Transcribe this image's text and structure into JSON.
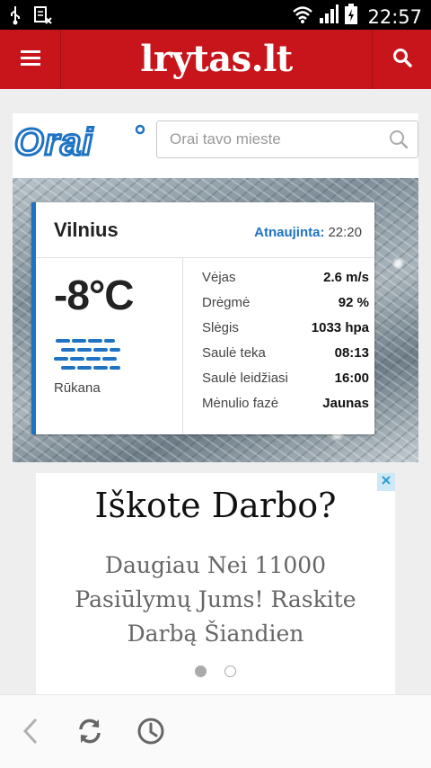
{
  "status_bar": {
    "time": "22:57"
  },
  "header": {
    "logo": "lrytas.lt"
  },
  "weather": {
    "brand": "Orai",
    "search_placeholder": "Orai tavo mieste",
    "city": "Vilnius",
    "updated_label": "Atnaujinta:",
    "updated_time": "22:20",
    "temperature": "-8°C",
    "condition": "Rūkana",
    "condition_icon": "fog-icon",
    "stats": [
      {
        "label": "Vėjas",
        "value": "2.6 m/s"
      },
      {
        "label": "Drėgmė",
        "value": "92 %"
      },
      {
        "label": "Slėgis",
        "value": "1033 hpa"
      },
      {
        "label": "Saulė teka",
        "value": "08:13"
      },
      {
        "label": "Saulė leidžiasi",
        "value": "16:00"
      },
      {
        "label": "Mėnulio fazė",
        "value": "Jaunas"
      }
    ],
    "accent_color": "#1f73c4"
  },
  "ad": {
    "headline": "Iškote Darbo?",
    "body": "Daugiau Nei 11000 Pasiūlymų Jums! Raskite Darbą Šiandien"
  },
  "colors": {
    "header_red": "#c8151b",
    "accent_blue": "#1f73c4"
  }
}
